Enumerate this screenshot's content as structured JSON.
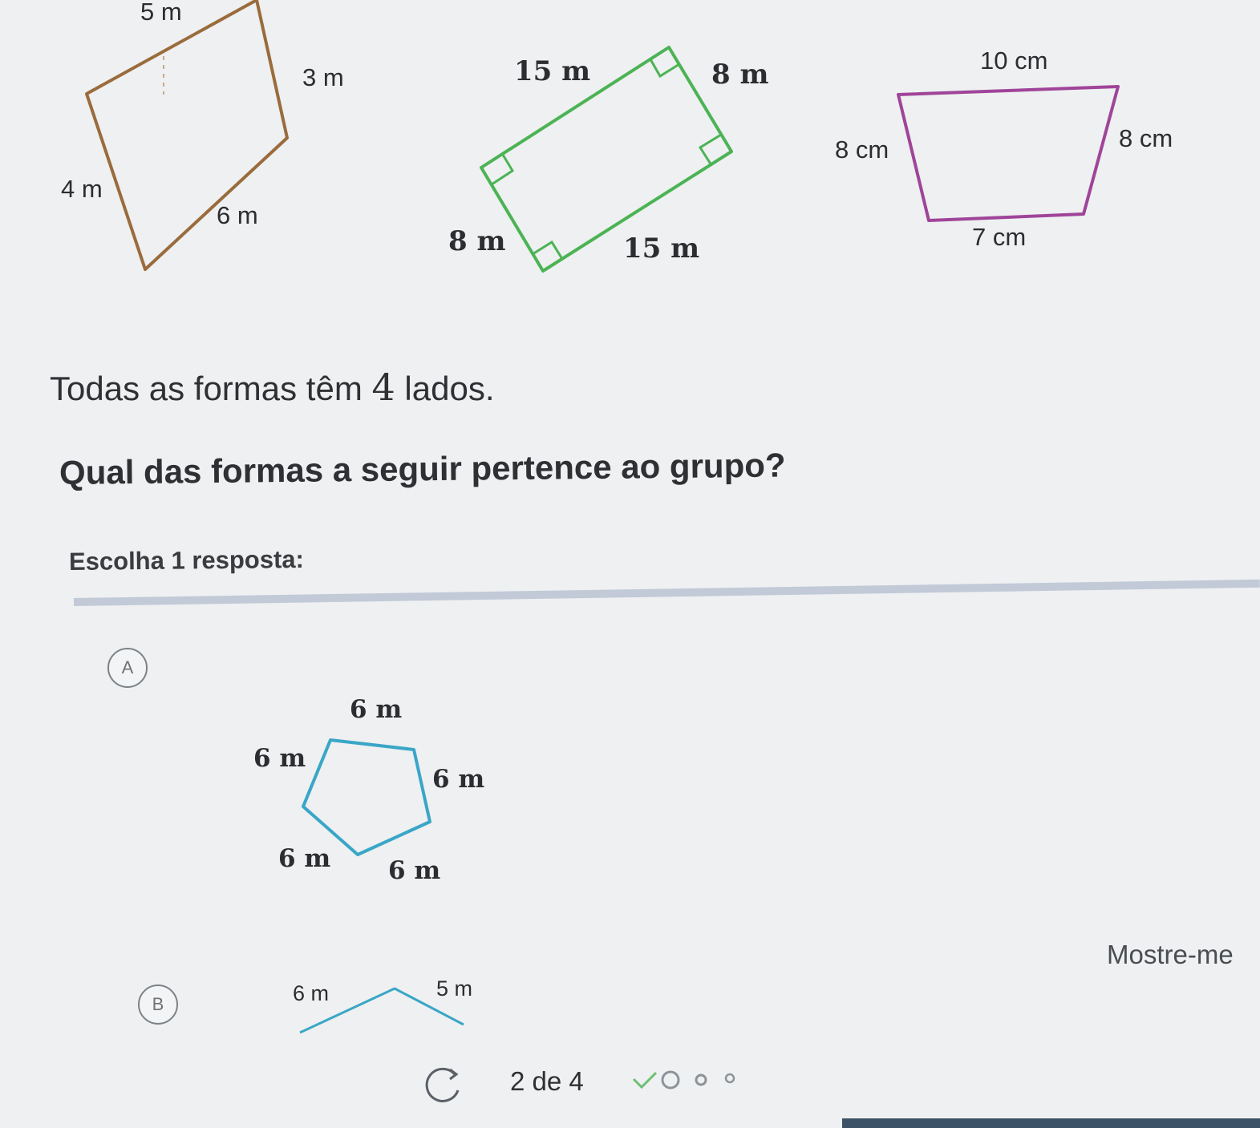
{
  "figures": {
    "quad_brown": {
      "color": "#9a6b3c",
      "labels": [
        "5 m",
        "3 m",
        "4 m",
        "6 m"
      ]
    },
    "rectangle_green": {
      "color": "#4cb354",
      "labels": [
        "15 m",
        "8 m",
        "8 m",
        "15 m"
      ]
    },
    "trapezoid_purple": {
      "color": "#a0449a",
      "labels": [
        "10 cm",
        "8 cm",
        "8 cm",
        "7 cm"
      ]
    }
  },
  "statement": {
    "before": "Todas as formas têm ",
    "number": "4",
    "after": " lados."
  },
  "question": "Qual das formas a seguir pertence ao grupo?",
  "instruction": "Escolha 1 resposta:",
  "choices": [
    {
      "letter": "A",
      "shape": "pentagon",
      "color": "#3aa6c7",
      "labels": [
        "6 m",
        "6 m",
        "6 m",
        "6 m",
        "6 m"
      ]
    },
    {
      "letter": "B",
      "color": "#3aa6c7",
      "labels": [
        "6 m",
        "5 m"
      ]
    }
  ],
  "hint_button": "Mostre-me",
  "progress": {
    "text": "2 de 4",
    "icons": [
      "check-icon",
      "circle-icon",
      "small-dot-icon",
      "small-dot-icon"
    ]
  }
}
